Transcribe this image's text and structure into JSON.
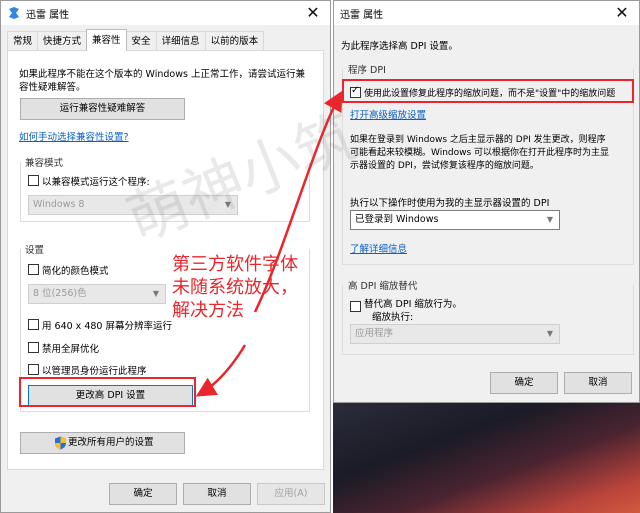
{
  "left_window": {
    "title": "迅雷 属性",
    "tabs": [
      {
        "label": "常规"
      },
      {
        "label": "快捷方式"
      },
      {
        "label": "兼容性"
      },
      {
        "label": "安全"
      },
      {
        "label": "详细信息"
      },
      {
        "label": "以前的版本"
      }
    ],
    "intro_line1": "如果此程序不能在这个版本的 Windows 上正常工作，请尝试运行兼",
    "intro_line2": "容性疑难解答。",
    "troubleshoot_button": "运行兼容性疑难解答",
    "manual_link": "如何手动选择兼容性设置?",
    "compat_mode": {
      "group_label": "兼容模式",
      "checkbox_label": "以兼容模式运行这个程序:",
      "os_value": "Windows 8"
    },
    "settings": {
      "group_label": "设置",
      "reduced_color_label": "简化的颜色模式",
      "color_value": "8 位(256)色",
      "resolution_label": "用 640 x 480 屏幕分辨率运行",
      "fullscreen_label": "禁用全屏优化",
      "admin_label": "以管理员身份运行此程序",
      "dpi_button": "更改高 DPI 设置"
    },
    "all_users_button": "更改所有用户的设置",
    "ok_button": "确定",
    "cancel_button": "取消",
    "apply_button": "应用(A)"
  },
  "right_window": {
    "title": "迅雷 属性",
    "header": "为此程序选择高 DPI 设置。",
    "program_dpi": {
      "group_label": "程序 DPI",
      "checkbox_label": "使用此设置修复此程序的缩放问题，而不是\"设置\"中的缩放问题",
      "advanced_link": "打开高级缩放设置",
      "desc_line1": "如果在登录到 Windows 之后主显示器的 DPI 发生更改，则程序",
      "desc_line2": "可能看起来较模糊。Windows 可以根据你在打开此程序时为主显",
      "desc_line3": "示器设置的 DPI，尝试修复该程序的缩放问题。",
      "select_label": "执行以下操作时使用为我的主显示器设置的 DPI",
      "select_value": "已登录到 Windows",
      "learn_more_link": "了解详细信息"
    },
    "override": {
      "group_label": "高 DPI 缩放替代",
      "checkbox_line1": "替代高 DPI 缩放行为。",
      "checkbox_line2": "缩放执行:",
      "select_value": "应用程序"
    },
    "ok_button": "确定",
    "cancel_button": "取消"
  },
  "annotation": {
    "line1": "第三方软件字体",
    "line2": "未随系统放大，",
    "line3": "解决方法",
    "color": "#e8262b"
  }
}
